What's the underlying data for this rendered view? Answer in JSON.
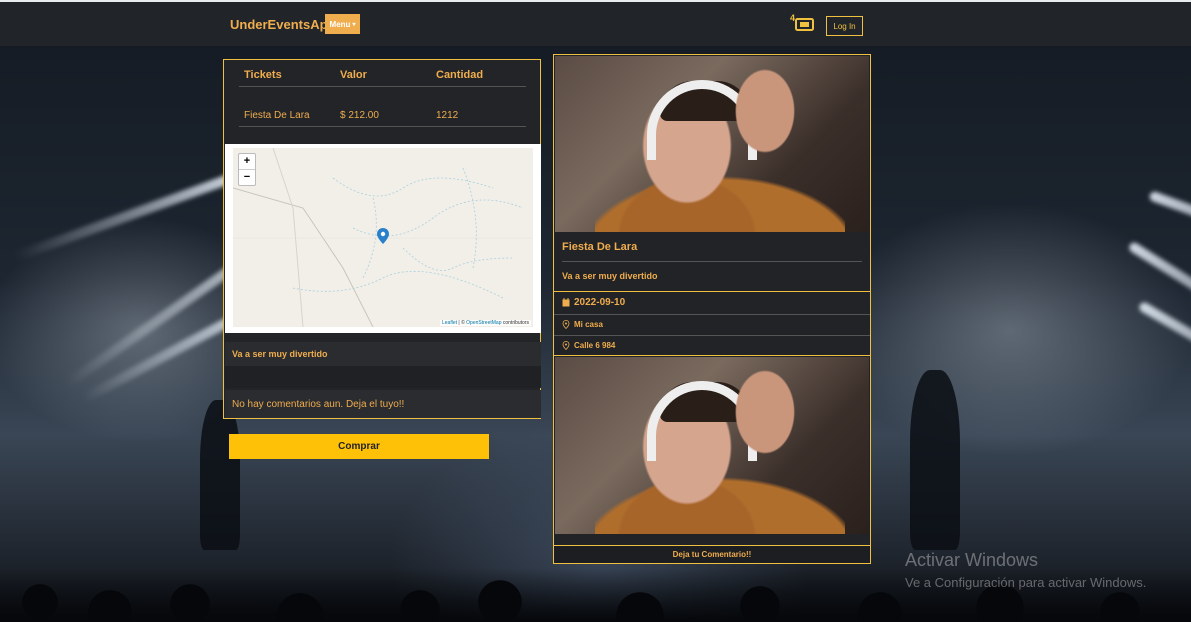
{
  "navbar": {
    "brand": "UnderEventsApp",
    "menu_label": "Menu",
    "ticket_count": "4",
    "login_label": "Log In"
  },
  "tickets": {
    "headers": [
      "Tickets",
      "Valor",
      "Cantidad"
    ],
    "rows": [
      {
        "name": "Fiesta De Lara",
        "price": "$ 212.00",
        "quantity": "1212"
      }
    ]
  },
  "map": {
    "zoom_in": "+",
    "zoom_out": "−",
    "attribution_leaflet": "Leaflet",
    "attribution_sep": " | © ",
    "attribution_osm": "OpenStreetMap",
    "attribution_suffix": " contributors"
  },
  "description": "Va a ser muy divertido",
  "comments_empty": "No hay comentarios aun. Deja el tuyo!!",
  "buy_label": "Comprar",
  "event": {
    "title": "Fiesta De Lara",
    "description": "Va a ser muy divertido",
    "date": "2022-09-10",
    "place": "Mi casa",
    "address": "Calle 6 984"
  },
  "comment_button": "Deja tu Comentario!!",
  "watermark": {
    "line1": "Activar Windows",
    "line2": "Ve a Configuración para activar Windows."
  },
  "colors": {
    "accent": "#f0ad4e",
    "border": "#f0c040",
    "buy": "#ffc107",
    "navbar": "#212529"
  }
}
